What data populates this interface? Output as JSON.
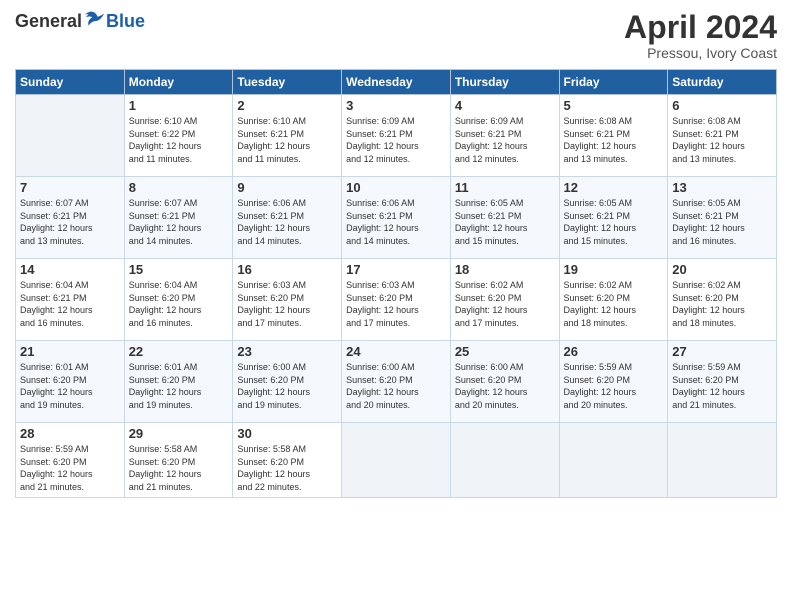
{
  "header": {
    "logo": {
      "general": "General",
      "blue": "Blue"
    },
    "title": "April 2024",
    "subtitle": "Pressou, Ivory Coast"
  },
  "calendar": {
    "days_header": [
      "Sunday",
      "Monday",
      "Tuesday",
      "Wednesday",
      "Thursday",
      "Friday",
      "Saturday"
    ],
    "weeks": [
      [
        {
          "day": "",
          "info": ""
        },
        {
          "day": "1",
          "info": "Sunrise: 6:10 AM\nSunset: 6:22 PM\nDaylight: 12 hours\nand 11 minutes."
        },
        {
          "day": "2",
          "info": "Sunrise: 6:10 AM\nSunset: 6:21 PM\nDaylight: 12 hours\nand 11 minutes."
        },
        {
          "day": "3",
          "info": "Sunrise: 6:09 AM\nSunset: 6:21 PM\nDaylight: 12 hours\nand 12 minutes."
        },
        {
          "day": "4",
          "info": "Sunrise: 6:09 AM\nSunset: 6:21 PM\nDaylight: 12 hours\nand 12 minutes."
        },
        {
          "day": "5",
          "info": "Sunrise: 6:08 AM\nSunset: 6:21 PM\nDaylight: 12 hours\nand 13 minutes."
        },
        {
          "day": "6",
          "info": "Sunrise: 6:08 AM\nSunset: 6:21 PM\nDaylight: 12 hours\nand 13 minutes."
        }
      ],
      [
        {
          "day": "7",
          "info": "Sunrise: 6:07 AM\nSunset: 6:21 PM\nDaylight: 12 hours\nand 13 minutes."
        },
        {
          "day": "8",
          "info": "Sunrise: 6:07 AM\nSunset: 6:21 PM\nDaylight: 12 hours\nand 14 minutes."
        },
        {
          "day": "9",
          "info": "Sunrise: 6:06 AM\nSunset: 6:21 PM\nDaylight: 12 hours\nand 14 minutes."
        },
        {
          "day": "10",
          "info": "Sunrise: 6:06 AM\nSunset: 6:21 PM\nDaylight: 12 hours\nand 14 minutes."
        },
        {
          "day": "11",
          "info": "Sunrise: 6:05 AM\nSunset: 6:21 PM\nDaylight: 12 hours\nand 15 minutes."
        },
        {
          "day": "12",
          "info": "Sunrise: 6:05 AM\nSunset: 6:21 PM\nDaylight: 12 hours\nand 15 minutes."
        },
        {
          "day": "13",
          "info": "Sunrise: 6:05 AM\nSunset: 6:21 PM\nDaylight: 12 hours\nand 16 minutes."
        }
      ],
      [
        {
          "day": "14",
          "info": "Sunrise: 6:04 AM\nSunset: 6:21 PM\nDaylight: 12 hours\nand 16 minutes."
        },
        {
          "day": "15",
          "info": "Sunrise: 6:04 AM\nSunset: 6:20 PM\nDaylight: 12 hours\nand 16 minutes."
        },
        {
          "day": "16",
          "info": "Sunrise: 6:03 AM\nSunset: 6:20 PM\nDaylight: 12 hours\nand 17 minutes."
        },
        {
          "day": "17",
          "info": "Sunrise: 6:03 AM\nSunset: 6:20 PM\nDaylight: 12 hours\nand 17 minutes."
        },
        {
          "day": "18",
          "info": "Sunrise: 6:02 AM\nSunset: 6:20 PM\nDaylight: 12 hours\nand 17 minutes."
        },
        {
          "day": "19",
          "info": "Sunrise: 6:02 AM\nSunset: 6:20 PM\nDaylight: 12 hours\nand 18 minutes."
        },
        {
          "day": "20",
          "info": "Sunrise: 6:02 AM\nSunset: 6:20 PM\nDaylight: 12 hours\nand 18 minutes."
        }
      ],
      [
        {
          "day": "21",
          "info": "Sunrise: 6:01 AM\nSunset: 6:20 PM\nDaylight: 12 hours\nand 19 minutes."
        },
        {
          "day": "22",
          "info": "Sunrise: 6:01 AM\nSunset: 6:20 PM\nDaylight: 12 hours\nand 19 minutes."
        },
        {
          "day": "23",
          "info": "Sunrise: 6:00 AM\nSunset: 6:20 PM\nDaylight: 12 hours\nand 19 minutes."
        },
        {
          "day": "24",
          "info": "Sunrise: 6:00 AM\nSunset: 6:20 PM\nDaylight: 12 hours\nand 20 minutes."
        },
        {
          "day": "25",
          "info": "Sunrise: 6:00 AM\nSunset: 6:20 PM\nDaylight: 12 hours\nand 20 minutes."
        },
        {
          "day": "26",
          "info": "Sunrise: 5:59 AM\nSunset: 6:20 PM\nDaylight: 12 hours\nand 20 minutes."
        },
        {
          "day": "27",
          "info": "Sunrise: 5:59 AM\nSunset: 6:20 PM\nDaylight: 12 hours\nand 21 minutes."
        }
      ],
      [
        {
          "day": "28",
          "info": "Sunrise: 5:59 AM\nSunset: 6:20 PM\nDaylight: 12 hours\nand 21 minutes."
        },
        {
          "day": "29",
          "info": "Sunrise: 5:58 AM\nSunset: 6:20 PM\nDaylight: 12 hours\nand 21 minutes."
        },
        {
          "day": "30",
          "info": "Sunrise: 5:58 AM\nSunset: 6:20 PM\nDaylight: 12 hours\nand 22 minutes."
        },
        {
          "day": "",
          "info": ""
        },
        {
          "day": "",
          "info": ""
        },
        {
          "day": "",
          "info": ""
        },
        {
          "day": "",
          "info": ""
        }
      ]
    ]
  }
}
